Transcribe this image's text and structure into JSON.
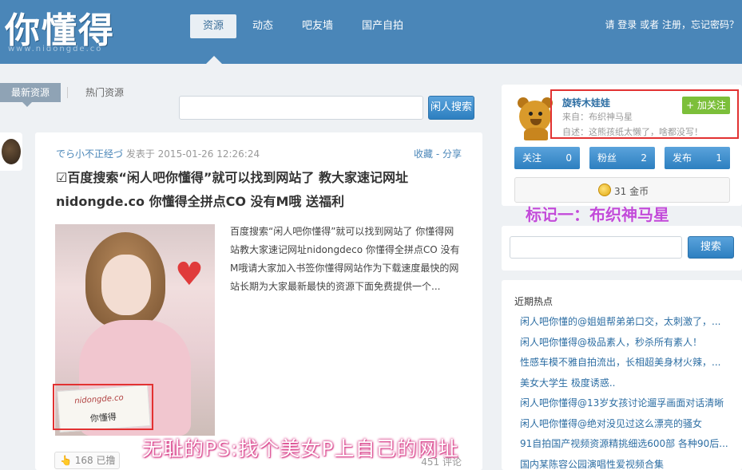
{
  "header": {
    "logo": "你懂得",
    "logo_sub": "www.nidongde.co",
    "nav": [
      "资源",
      "动态",
      "吧友墙",
      "国产自拍"
    ],
    "login_prefix": "请",
    "login_login": "登录",
    "login_or": "或者",
    "login_register": "注册",
    "login_forgot": "，忘记密码？"
  },
  "tabs": [
    "最新资源",
    "热门资源"
  ],
  "search": {
    "placeholder": "",
    "button": "闲人搜索"
  },
  "post": {
    "author": "でら小不正经づ",
    "time": "发表于 2015-01-26 12:26:24",
    "action_collect": "收藏",
    "action_sep": "-",
    "action_share": "分享",
    "title": "☑百度搜索“闲人吧你懂得”就可以找到网站了 教大家速记网址 nidongde.co 你懂得全拼点CO 没有M哦 送福利",
    "excerpt": "百度搜索“闲人吧你懂得”就可以找到网站了 你懂得网站教大家速记网址nidongdeco 你懂得全拼点CO 没有M哦请大家加入书签你懂得网站作为下载速度最快的网站长期为大家最新最快的资源下面免费提供一个...",
    "image_card_text1": "nidongde.co",
    "image_card_text2": "你懂得",
    "likes": "168 已撸",
    "comments": "451 评论"
  },
  "caption": "无耻的PS:找个美女P上自己的网址",
  "user": {
    "name": "旋转木娃娃",
    "follow": "+ 加关注",
    "from": "来自：布织神马星",
    "desc": "自述：这熊孩纸太懒了，啥都没写！",
    "stats": [
      {
        "label": "关注",
        "value": "0"
      },
      {
        "label": "粉丝",
        "value": "2"
      },
      {
        "label": "发布",
        "value": "1"
      }
    ],
    "coins": "31 金币"
  },
  "mark": "标记一：布织神马星",
  "side_search": {
    "placeholder": "",
    "button": "搜索"
  },
  "hot": {
    "title": "近期热点",
    "items": [
      "闲人吧你懂的@姐姐帮弟弟口交，太刺激了，...",
      "闲人吧你懂得@极品素人，秒杀所有素人！",
      "性感车模不雅自拍流出，长相超美身材火辣，...",
      "美女大学生 极度诱惑..",
      "闲人吧你懂得@13岁女孩讨论遛孚画面对话清晰",
      "闲人吧你懂得@绝对没见过这么漂亮的骚女",
      "91自拍国产视频资源精挑细选600部 各种90后...",
      "国内某陈容公园演唱性爱视频合集"
    ]
  },
  "colors": {
    "header": "#4a86b8",
    "accent": "#2d7fc0",
    "follow": "#7cbf3a",
    "highlight": "#e23232",
    "mark": "#c24bd9"
  }
}
